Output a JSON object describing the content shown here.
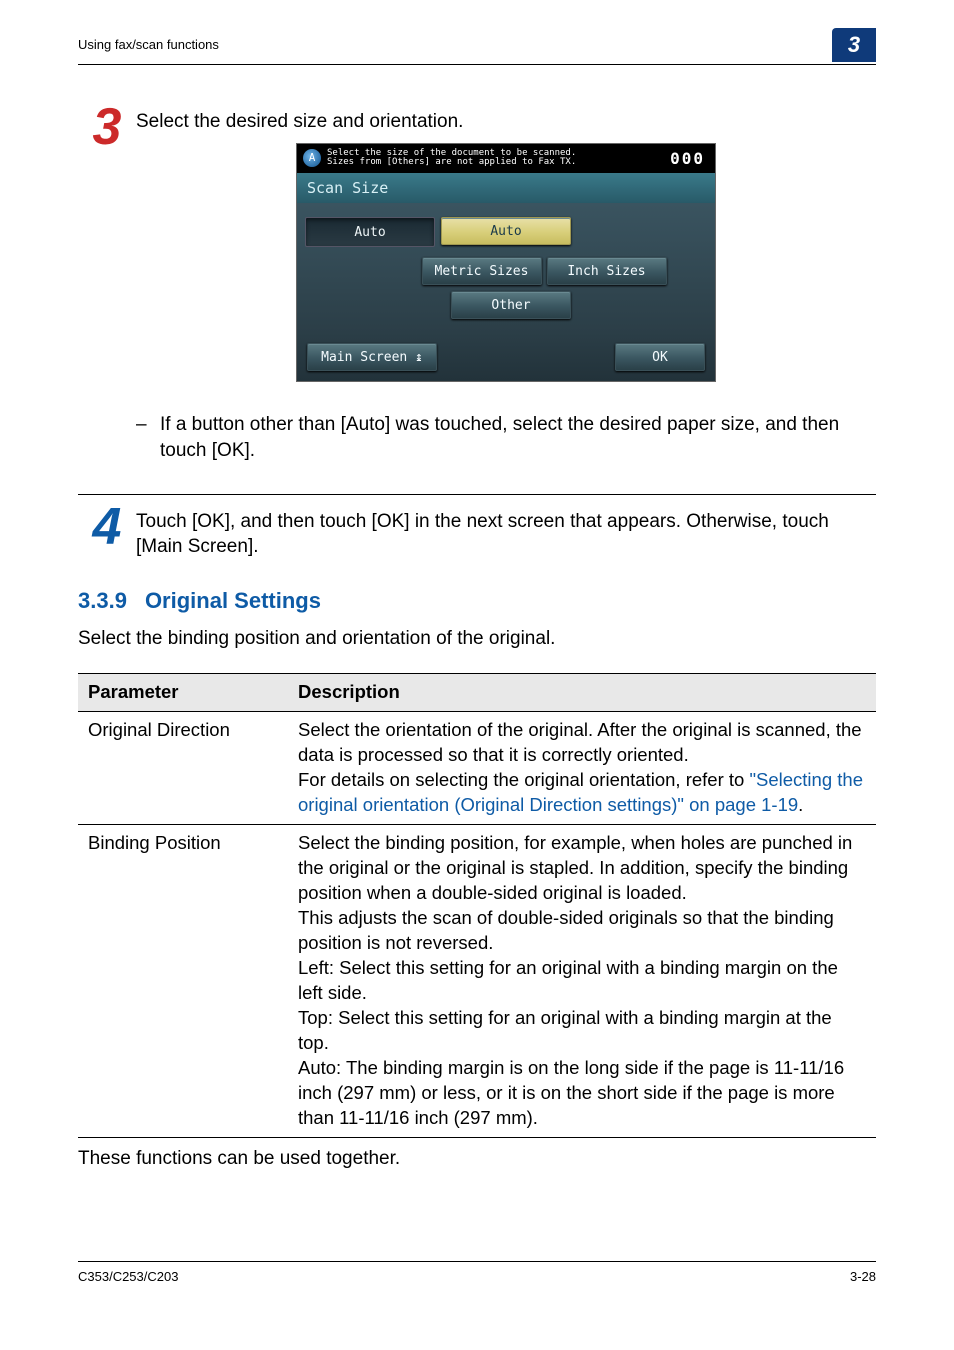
{
  "header": {
    "left": "Using fax/scan functions",
    "chapter": "3"
  },
  "step3": {
    "num": "3",
    "text": "Select the desired size and orientation.",
    "screenshot": {
      "top_line1": "Select the size of the document to be scanned.",
      "top_line2": "Sizes from [Others] are not applied to Fax TX.",
      "counter": "000",
      "title": "Scan Size",
      "auto_display": "Auto",
      "auto_btn": "Auto",
      "metric": "Metric Sizes",
      "inch": "Inch Sizes",
      "other": "Other",
      "main_screen": "Main Screen",
      "ok": "OK"
    },
    "note": "If a button other than [Auto] was touched, select the desired paper size, and then touch [OK]."
  },
  "step4": {
    "num": "4",
    "text": "Touch [OK], and then touch [OK] in the next screen that appears. Otherwise, touch [Main Screen]."
  },
  "section": {
    "num": "3.3.9",
    "title": "Original Settings",
    "intro": "Select the binding position and orientation of the original.",
    "th_param": "Parameter",
    "th_desc": "Description",
    "rows": [
      {
        "param": "Original Direction",
        "plain1": "Select the orientation of the original. After the original is scanned, the data is processed so that it is correctly oriented.",
        "plain2": "For details on selecting the original orientation, refer to ",
        "link": "\"Selecting the original orientation (Original Direction settings)\" on page 1-19",
        "after_link": "."
      },
      {
        "param": "Binding Position",
        "desc": "Select the binding position, for example, when holes are punched in the original or the original is stapled. In addition, specify the binding position when a double-sided original is loaded.\nThis adjusts the scan of double-sided originals so that the binding position is not reversed.\nLeft: Select this setting for an original with a binding margin on the left side.\nTop: Select this setting for an original with a binding margin at the top.\nAuto: The binding margin is on the long side if the page is 11-11/16 inch (297 mm) or less, or it is on the short side if the page is more than 11-11/16 inch (297 mm)."
      }
    ],
    "after": "These functions can be used together."
  },
  "footer": {
    "left": "C353/C253/C203",
    "right": "3-28"
  }
}
